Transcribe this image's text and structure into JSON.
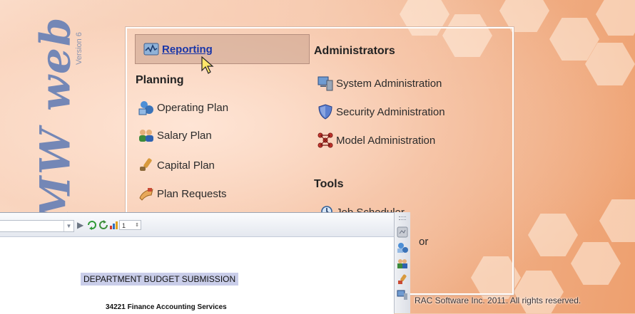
{
  "logo": {
    "text": "MW web",
    "version": "Version 6"
  },
  "reporting": {
    "label": "Reporting"
  },
  "planning": {
    "heading": "Planning",
    "items": [
      {
        "label": "Operating Plan",
        "icon": "operating-plan-icon"
      },
      {
        "label": "Salary Plan",
        "icon": "salary-plan-icon"
      },
      {
        "label": "Capital Plan",
        "icon": "capital-plan-icon"
      },
      {
        "label": "Plan Requests",
        "icon": "plan-requests-icon"
      }
    ]
  },
  "administrators": {
    "heading": "Administrators",
    "items": [
      {
        "label": "System Administration",
        "icon": "system-admin-icon"
      },
      {
        "label": "Security Administration",
        "icon": "security-admin-icon"
      },
      {
        "label": "Model Administration",
        "icon": "model-admin-icon"
      }
    ]
  },
  "tools": {
    "heading": "Tools",
    "items": [
      {
        "label": "Job Scheduler",
        "icon": "job-scheduler-icon"
      },
      {
        "label": "or",
        "icon": ""
      }
    ]
  },
  "document": {
    "page_value": "1",
    "title": "DEPARTMENT BUDGET SUBMISSION",
    "subtitle": "34221 Finance Accounting Services"
  },
  "footer": {
    "copyright": "RAC Software Inc. 2011. All rights reserved."
  },
  "colors": {
    "link": "#1a36a8",
    "logo": "#7487b6",
    "highlight": "#c9cde9"
  }
}
